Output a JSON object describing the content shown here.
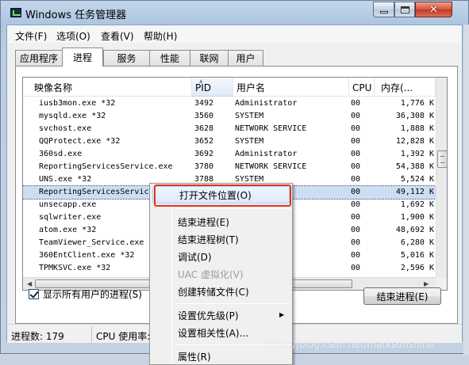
{
  "window": {
    "title": "Windows 任务管理器",
    "minimize_icon": "minimize-icon",
    "maximize_icon": "maximize-icon",
    "close_icon": "close-icon",
    "close_glyph": "✕"
  },
  "menu": {
    "file": "文件(F)",
    "options": "选项(O)",
    "view": "查看(V)",
    "help": "帮助(H)"
  },
  "tabs": [
    {
      "label": "应用程序",
      "active": false
    },
    {
      "label": "进程",
      "active": true
    },
    {
      "label": "服务",
      "active": false
    },
    {
      "label": "性能",
      "active": false
    },
    {
      "label": "联网",
      "active": false
    },
    {
      "label": "用户",
      "active": false
    }
  ],
  "columns": {
    "name": "映像名称",
    "pid": "PID",
    "user": "用户名",
    "cpu": "CPU",
    "memory": "内存(..."
  },
  "processes": [
    {
      "name": "iusb3mon.exe *32",
      "pid": "3492",
      "user": "Administrator",
      "cpu": "00",
      "mem": "1,776 K"
    },
    {
      "name": "mysqld.exe *32",
      "pid": "3560",
      "user": "SYSTEM",
      "cpu": "00",
      "mem": "36,308 K"
    },
    {
      "name": "svchost.exe",
      "pid": "3628",
      "user": "NETWORK SERVICE",
      "cpu": "00",
      "mem": "1,888 K"
    },
    {
      "name": "QQProtect.exe *32",
      "pid": "3652",
      "user": "SYSTEM",
      "cpu": "00",
      "mem": "12,828 K"
    },
    {
      "name": "360sd.exe",
      "pid": "3692",
      "user": "Administrator",
      "cpu": "00",
      "mem": "1,392 K"
    },
    {
      "name": "ReportingServicesService.exe",
      "pid": "3780",
      "user": "NETWORK SERVICE",
      "cpu": "00",
      "mem": "54,388 K"
    },
    {
      "name": "UNS.exe *32",
      "pid": "3788",
      "user": "SYSTEM",
      "cpu": "00",
      "mem": "5,524 K"
    },
    {
      "name": "ReportingServicesService.",
      "pid": "",
      "user": "CE",
      "cpu": "00",
      "mem": "49,112 K",
      "selected": true
    },
    {
      "name": "unsecapp.exe",
      "pid": "",
      "user": "",
      "cpu": "00",
      "mem": "1,692 K"
    },
    {
      "name": "sqlwriter.exe",
      "pid": "",
      "user": "",
      "cpu": "00",
      "mem": "1,900 K"
    },
    {
      "name": "atom.exe *32",
      "pid": "",
      "user": "",
      "cpu": "00",
      "mem": "48,692 K"
    },
    {
      "name": "TeamViewer_Service.exe *3",
      "pid": "",
      "user": "",
      "cpu": "00",
      "mem": "6,280 K"
    },
    {
      "name": "360EntClient.exe *32",
      "pid": "",
      "user": "",
      "cpu": "00",
      "mem": "5,016 K"
    },
    {
      "name": "TPMKSVC.exe *32",
      "pid": "",
      "user": "",
      "cpu": "00",
      "mem": "2,596 K"
    }
  ],
  "show_all_label": "显示所有用户的进程(S)",
  "show_all_checked": true,
  "end_process_button": "结束进程(E)",
  "status": {
    "process_count": "进程数: 179",
    "cpu_usage": "CPU 使用率:"
  },
  "context_menu": {
    "items": [
      {
        "label": "打开文件位置(O)",
        "highlighted": true
      },
      {
        "label": "结束进程(E)"
      },
      {
        "label": "结束进程树(T)"
      },
      {
        "label": "调试(D)"
      },
      {
        "label": "UAC 虚拟化(V)",
        "disabled": true
      },
      {
        "label": "创建转储文件(C)"
      },
      {
        "label": "设置优先级(P)",
        "submenu": true
      },
      {
        "label": "设置相关性(A)..."
      },
      {
        "label": "属性(R)"
      }
    ],
    "submenu_glyph": "▶"
  },
  "scrollbar_glyphs": {
    "left": "◀",
    "right": "▶",
    "sort": "▲"
  },
  "watermark": "https://blog.csdn.net/marksunshine"
}
